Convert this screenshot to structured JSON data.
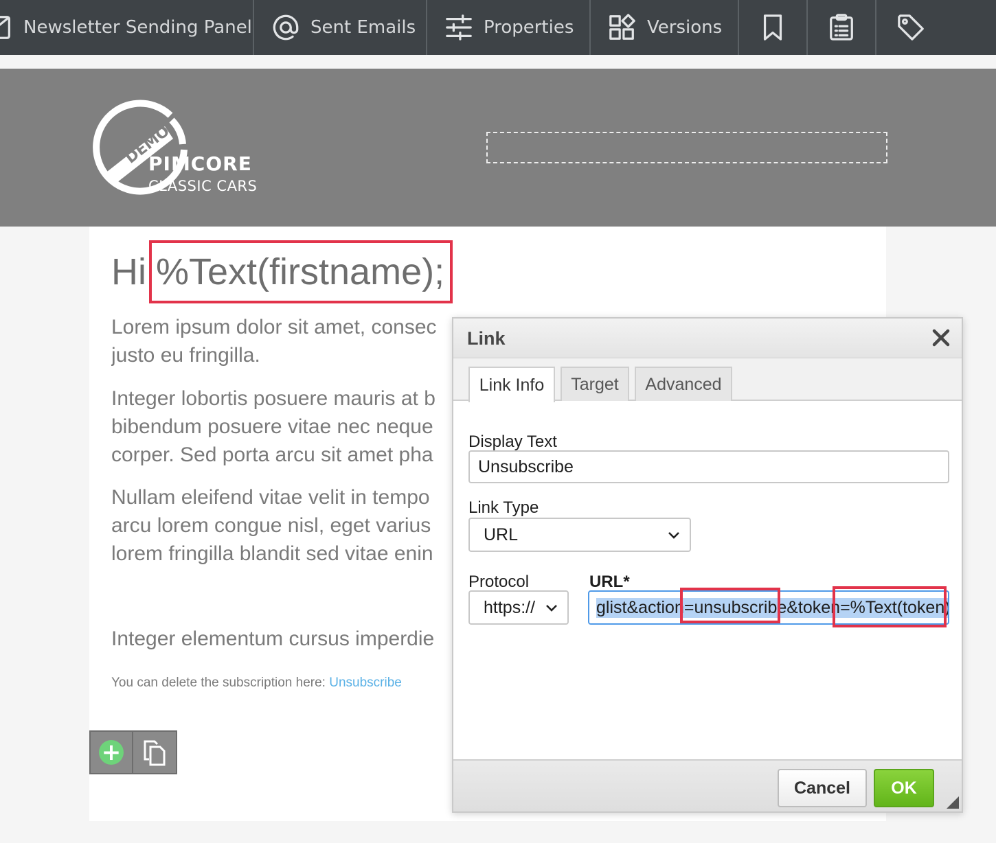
{
  "toolbar": {
    "items": [
      {
        "label": "Newsletter Sending Panel",
        "icon": "newsletter-icon"
      },
      {
        "label": "Sent Emails",
        "icon": "at-sign-icon"
      },
      {
        "label": "Properties",
        "icon": "sliders-icon"
      },
      {
        "label": "Versions",
        "icon": "versions-grid-icon"
      }
    ],
    "icon_buttons": [
      "bookmark-icon",
      "clipboard-list-icon",
      "tag-icon"
    ]
  },
  "header": {
    "logo": {
      "badge": "DEMO",
      "brand": "PIMCORE",
      "subtitle": "CLASSIC CARS"
    }
  },
  "email": {
    "greeting_prefix": "Hi",
    "greeting_placeholder": "%Text(firstname);",
    "paragraphs": [
      [
        "Lorem ipsum dolor sit amet, consec",
        "justo eu fringilla."
      ],
      [
        "Integer lobortis posuere mauris at b",
        "bibendum posuere vitae nec neque",
        "corper. Sed porta arcu sit amet pha"
      ],
      [
        "Nullam eleifend vitae velit in tempo",
        "arcu lorem congue nisl, eget varius",
        "lorem fringilla blandit sed vitae enin"
      ],
      [
        "Integer elementum cursus imperdie"
      ]
    ],
    "unsubscribe_note": "You can delete the subscription here:",
    "unsubscribe_link": "Unsubscribe"
  },
  "dialog": {
    "title": "Link",
    "tabs": [
      "Link Info",
      "Target",
      "Advanced"
    ],
    "active_tab": "Link Info",
    "display_text_label": "Display Text",
    "display_text_value": "Unsubscribe",
    "link_type_label": "Link Type",
    "link_type_value": "URL",
    "protocol_label": "Protocol",
    "protocol_value": "https://",
    "url_label": "URL*",
    "url_visible_value": "glist&action=unsubscribe&token=%Text(token);",
    "cancel_label": "Cancel",
    "ok_label": "OK"
  },
  "colors": {
    "toolbar_bg": "#3e4347",
    "header_band": "#808080",
    "highlight_red": "#e2334a",
    "ok_green": "#62b51a",
    "link_blue": "#5ab1e6",
    "selection_blue": "#b5d3f5"
  }
}
